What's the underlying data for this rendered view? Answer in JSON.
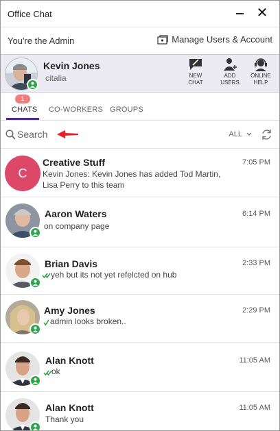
{
  "window": {
    "title": "Office Chat"
  },
  "admin": {
    "label": "You're the Admin",
    "manage_label": "Manage Users & Account"
  },
  "profile": {
    "name": "Kevin Jones",
    "org": "citalia"
  },
  "actions": [
    {
      "line1": "NEW",
      "line2": "CHAT",
      "icon": "new-chat-icon"
    },
    {
      "line1": "ADD",
      "line2": "USERS",
      "icon": "add-user-icon"
    },
    {
      "line1": "ONLINE",
      "line2": "HELP",
      "icon": "headset-icon"
    }
  ],
  "tabs": [
    {
      "label": "CHATS",
      "badge": "1"
    },
    {
      "label": "CO-WORKERS"
    },
    {
      "label": "GROUPS"
    }
  ],
  "search": {
    "placeholder": "Search",
    "filter": "ALL"
  },
  "chats": [
    {
      "name": "Creative Stuff",
      "time": "7:05 PM",
      "message_line1": "Kevin Jones: Kevin Jones has added Tod Martin,",
      "message_line2": "Lisa Perry to this team",
      "initial": "C"
    },
    {
      "name": "Aaron Waters",
      "time": "6:14 PM",
      "message": "on company page"
    },
    {
      "name": "Brian Davis",
      "time": "2:33 PM",
      "message": "yeh but its not yet refelcted on hub"
    },
    {
      "name": "Amy Jones",
      "time": "2:29 PM",
      "message": "admin looks broken.."
    },
    {
      "name": "Alan Knott",
      "time": "11:05 AM",
      "message": "ok"
    },
    {
      "name": "Alan Knott",
      "time": "11:05 AM",
      "message": "Thank you"
    }
  ],
  "colors": {
    "accent": "#4b2d83",
    "status_online": "#2ba84a",
    "badge": "#ef7d7d",
    "arrow": "#e8202a",
    "group_avatar": "#dd4868",
    "profile_bg": "#ecebf3"
  }
}
